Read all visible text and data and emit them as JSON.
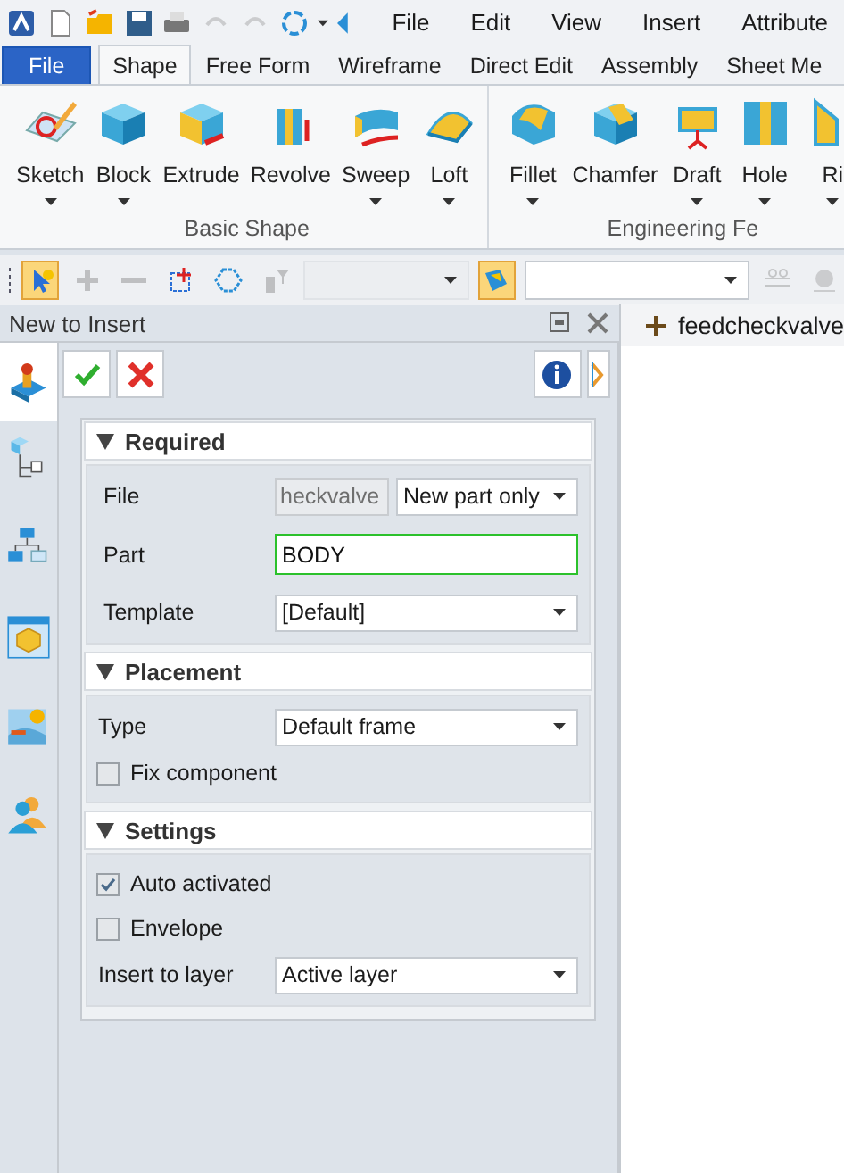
{
  "quick_access": {
    "buttons": [
      {
        "disabled": false
      },
      {
        "disabled": false
      },
      {
        "disabled": false
      },
      {
        "disabled": false
      },
      {
        "disabled": false
      },
      {
        "disabled": true
      },
      {
        "disabled": true
      },
      {
        "disabled": false
      }
    ],
    "menus": [
      {
        "label": "File"
      },
      {
        "label": "Edit"
      },
      {
        "label": "View"
      },
      {
        "label": "Insert"
      },
      {
        "label": "Attribute"
      }
    ]
  },
  "ribbon": {
    "tabs": [
      {
        "label": "File",
        "kind": "file",
        "selected": false
      },
      {
        "label": "Shape",
        "kind": "tab",
        "selected": true
      },
      {
        "label": "Free Form",
        "kind": "tab",
        "selected": false
      },
      {
        "label": "Wireframe",
        "kind": "tab",
        "selected": false
      },
      {
        "label": "Direct Edit",
        "kind": "tab",
        "selected": false
      },
      {
        "label": "Assembly",
        "kind": "tab",
        "selected": false
      },
      {
        "label": "Sheet Me",
        "kind": "tab",
        "selected": false
      }
    ],
    "groups": [
      {
        "label": "Basic Shape",
        "tools": [
          {
            "label": "Sketch",
            "dropdown": true
          },
          {
            "label": "Block",
            "dropdown": true
          },
          {
            "label": "Extrude",
            "dropdown": false
          },
          {
            "label": "Revolve",
            "dropdown": false
          },
          {
            "label": "Sweep",
            "dropdown": true
          },
          {
            "label": "Loft",
            "dropdown": true
          }
        ]
      },
      {
        "label": "Engineering Fe",
        "tools": [
          {
            "label": "Fillet",
            "dropdown": true
          },
          {
            "label": "Chamfer",
            "dropdown": false
          },
          {
            "label": "Draft",
            "dropdown": true
          },
          {
            "label": "Hole",
            "dropdown": true
          },
          {
            "label": "Ri",
            "dropdown": true
          }
        ]
      }
    ]
  },
  "toolbar": [
    {
      "kind": "button",
      "selected": true,
      "disabled": false
    },
    {
      "kind": "button",
      "selected": false,
      "disabled": true
    },
    {
      "kind": "button",
      "selected": false,
      "disabled": true
    },
    {
      "kind": "button",
      "selected": false,
      "disabled": false
    },
    {
      "kind": "button",
      "selected": false,
      "disabled": false
    },
    {
      "kind": "button",
      "selected": false,
      "disabled": true
    },
    {
      "kind": "combo",
      "disabled": true
    },
    {
      "kind": "button",
      "selected": true,
      "disabled": false
    },
    {
      "kind": "combo",
      "disabled": false
    },
    {
      "kind": "button",
      "selected": false,
      "disabled": true
    },
    {
      "kind": "button",
      "selected": false,
      "disabled": true
    }
  ],
  "panel": {
    "title": "New to Insert",
    "side_tabs": [
      {
        "selected": true
      },
      {
        "selected": false
      },
      {
        "selected": false
      },
      {
        "selected": false
      },
      {
        "selected": false
      },
      {
        "selected": false
      }
    ],
    "sections": [
      {
        "title": "Required",
        "expanded": true,
        "rows": [
          {
            "kind": "controls",
            "label": "File",
            "controls": [
              {
                "kind": "text",
                "value": "heckvalve",
                "disabled": true
              },
              {
                "kind": "select",
                "value": "New part only"
              }
            ]
          },
          {
            "kind": "controls",
            "label": "Part",
            "controls": [
              {
                "kind": "text",
                "value": "BODY",
                "disabled": false,
                "focused": true
              }
            ]
          },
          {
            "kind": "controls",
            "label": "Template",
            "controls": [
              {
                "kind": "select",
                "value": "[Default]"
              }
            ]
          }
        ]
      },
      {
        "title": "Placement",
        "expanded": true,
        "rows": [
          {
            "kind": "controls",
            "label": "Type",
            "controls": [
              {
                "kind": "select",
                "value": "Default frame"
              }
            ]
          },
          {
            "kind": "checkbox",
            "label": "Fix component",
            "checked": false
          }
        ]
      },
      {
        "title": "Settings",
        "expanded": true,
        "rows": [
          {
            "kind": "checkbox",
            "label": "Auto activated",
            "checked": true
          },
          {
            "kind": "checkbox",
            "label": "Envelope",
            "checked": false
          },
          {
            "kind": "controls",
            "label": "Insert to layer",
            "controls": [
              {
                "kind": "select",
                "value": "Active layer"
              }
            ]
          }
        ]
      }
    ]
  },
  "document_tab": {
    "label": "feedcheckvalve"
  }
}
